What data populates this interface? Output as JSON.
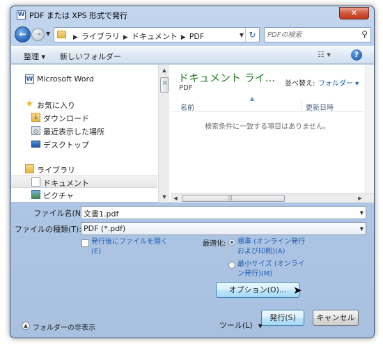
{
  "window": {
    "title": "PDF または XPS 形式で発行",
    "icon_letter": "W",
    "close_symbol": "✕"
  },
  "address": {
    "crumbs": [
      "ライブラリ",
      "ドキュメント",
      "PDF"
    ],
    "search_placeholder": "PDFの検索"
  },
  "toolbar": {
    "organize_label": "整理 ▾",
    "new_folder_label": "新しいフォルダー"
  },
  "navpane": {
    "items": [
      {
        "label": "Microsoft Word",
        "icon": "word-icon",
        "selected": false
      },
      {
        "label": "お気に入り",
        "icon": "star-icon",
        "selected": false
      },
      {
        "label": "ダウンロード",
        "icon": "downloads-folder-icon",
        "selected": false
      },
      {
        "label": "最近表示した場所",
        "icon": "recent-places-icon",
        "selected": false
      },
      {
        "label": "デスクトップ",
        "icon": "desktop-icon",
        "selected": false
      },
      {
        "label": "ライブラリ",
        "icon": "library-icon",
        "selected": false
      },
      {
        "label": "ドキュメント",
        "icon": "document-icon",
        "selected": true
      },
      {
        "label": "ピクチャ",
        "icon": "picture-icon",
        "selected": false
      }
    ]
  },
  "filepane": {
    "library_title": "ドキュメント ライ...",
    "library_subtitle": "PDF",
    "arrange_label": "並べ替え:",
    "arrange_value": "フォルダー ▾",
    "col_name": "名前",
    "col_date": "更新日時",
    "empty_message": "検索条件に一致する項目はありません。"
  },
  "form": {
    "filename_label": "ファイル名(N):",
    "filename_value": "文書1.pdf",
    "filetype_label": "ファイルの種類(T):",
    "filetype_value": "PDF (*.pdf)",
    "open_after_label_1": "発行後にファイルを開く",
    "open_after_label_2": "(E)",
    "open_after_checked": false,
    "optimize_label": "最適化:",
    "opt_standard_1": "標準 (オンライン発行",
    "opt_standard_2": "および印刷)(A)",
    "opt_min_1": "最小サイズ (オンライ",
    "opt_min_2": "ン発行)(M)",
    "selected_optimization": "standard",
    "options_button": "オプション(O)..."
  },
  "footer": {
    "hide_folders_label": "フォルダーの非表示",
    "tools_label": "ツール(L)",
    "publish_button": "発行(S)",
    "cancel_button": "キャンセル"
  }
}
